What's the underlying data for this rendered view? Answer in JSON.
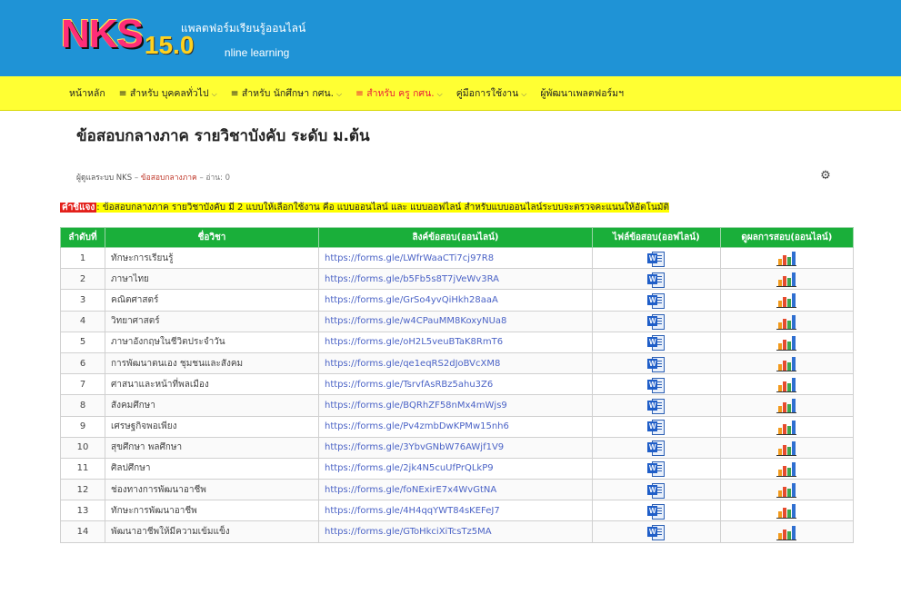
{
  "header": {
    "brand": "NKS",
    "version": "15.0",
    "tagline": "แพลตฟอร์มเรียนรู้ออนไลน์",
    "online_suffix": "nline learning"
  },
  "nav": {
    "items": [
      {
        "label": "หน้าหลัก",
        "dropdown": false
      },
      {
        "label": "≡ สำหรับ บุคคลทั่วไป",
        "dropdown": true
      },
      {
        "label": "≡ สำหรับ นักศึกษา กศน.",
        "dropdown": true
      },
      {
        "label": "≡ สำหรับ ครู กศน.",
        "dropdown": true,
        "active": true
      },
      {
        "label": "คู่มือการใช้งาน",
        "dropdown": true
      },
      {
        "label": "ผู้พัฒนาเพลตฟอร์มฯ",
        "dropdown": false
      }
    ]
  },
  "page": {
    "title": "ข้อสอบกลางภาค รายวิชาบังคับ ระดับ ม.ต้น",
    "author": "ผู้ดูแลระบบ NKS",
    "category": "ข้อสอบกลางภาค",
    "reads": "อ่าน: 0"
  },
  "notice": {
    "tag": "คำชี้แจง",
    "text": ": ข้อสอบกลางภาค รายวิชาบังคับ มี 2 แบบให้เลือกใช้งาน คือ แบบออนไลน์ และ แบบออฟไลน์ สำหรับแบบออนไลน์ระบบจะตรวจคะแนนให้อัตโนมัติ"
  },
  "table": {
    "headers": [
      "ลำดับที่",
      "ชื่อวิชา",
      "ลิงค์ข้อสอบ(ออนไลน์)",
      "ไฟล์ข้อสอบ(ออฟไลน์)",
      "ดูผลการสอบ(ออนไลน์)"
    ],
    "rows": [
      {
        "num": "1",
        "subject": "ทักษะการเรียนรู้",
        "url": "https://forms.gle/LWfrWaaCTi7cj97R8"
      },
      {
        "num": "2",
        "subject": "ภาษาไทย",
        "url": "https://forms.gle/b5Fb5s8T7jVeWv3RA"
      },
      {
        "num": "3",
        "subject": "คณิตศาสตร์",
        "url": "https://forms.gle/GrSo4yvQiHkh28aaA"
      },
      {
        "num": "4",
        "subject": "วิทยาศาสตร์",
        "url": "https://forms.gle/w4CPauMM8KoxyNUa8"
      },
      {
        "num": "5",
        "subject": "ภาษาอังกฤษในชีวิตประจำวัน",
        "url": "https://forms.gle/oH2L5veuBTaK8RmT6"
      },
      {
        "num": "6",
        "subject": "การพัฒนาตนเอง ชุมชนและสังคม",
        "url": "https://forms.gle/qe1eqRS2dJoBVcXM8"
      },
      {
        "num": "7",
        "subject": "ศาสนาและหน้าที่พลเมือง",
        "url": "https://forms.gle/TsrvfAsRBz5ahu3Z6"
      },
      {
        "num": "8",
        "subject": "สังคมศึกษา",
        "url": "https://forms.gle/BQRhZF58nMx4mWjs9"
      },
      {
        "num": "9",
        "subject": "เศรษฐกิจพอเพียง",
        "url": "https://forms.gle/Pv4zmbDwKPMw15nh6"
      },
      {
        "num": "10",
        "subject": "สุขศึกษา พลศึกษา",
        "url": "https://forms.gle/3YbvGNbW76AWjf1V9"
      },
      {
        "num": "11",
        "subject": "ศิลปศึกษา",
        "url": "https://forms.gle/2jk4N5cuUfPrQLkP9"
      },
      {
        "num": "12",
        "subject": "ช่องทางการพัฒนาอาชีพ",
        "url": "https://forms.gle/foNExirE7x4WvGtNA"
      },
      {
        "num": "13",
        "subject": "ทักษะการพัฒนาอาชีพ",
        "url": "https://forms.gle/4H4qqYWT84sKEFeJ7"
      },
      {
        "num": "14",
        "subject": "พัฒนาอาชีพให้มีความเข้มแข็ง",
        "url": "https://forms.gle/GToHkciXiTcsTz5MA"
      }
    ]
  },
  "icons": {
    "word": "word-doc-icon",
    "chart": "bar-chart-icon",
    "settings": "gear-icon"
  },
  "colors": {
    "banner": "#1f93d6",
    "nav": "#ffff33",
    "table_header": "#1aaf3a",
    "link": "#4b63c6",
    "notice_tag": "#e3201b",
    "active_nav": "#e8203a"
  }
}
